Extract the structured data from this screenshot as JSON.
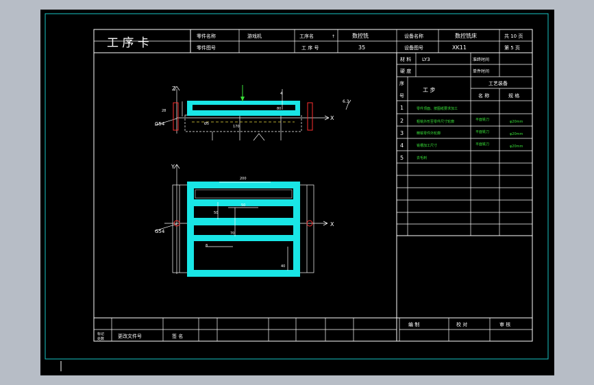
{
  "header": {
    "title": "工 序 卡",
    "part_name_label": "零件名称",
    "part_name_value": "游戏机",
    "part_no_label": "零件图号",
    "process_name_label": "工序名",
    "process_name_mark": "↑",
    "process_name_value": "数控铣",
    "process_no_label": "工 序 号",
    "process_no_value": "35",
    "equip_name_label": "设备名称",
    "equip_name_value": "数控铣床",
    "equip_no_label": "设备图号",
    "equip_no_value": "XK11",
    "total_pages": "共 10 页",
    "page_no": "第 5 页"
  },
  "info": {
    "material_label": "材 料",
    "material_value": "LY3",
    "hardness_label": "硬 度",
    "prep_time_label": "准终时间",
    "unit_time_label": "单件时间"
  },
  "steps_header": {
    "seq_label": "序",
    "no_label": "号",
    "step_label": "工 步",
    "equip_group_label": "工艺装备",
    "name_label": "名 称",
    "spec_label": "规 格"
  },
  "steps": [
    {
      "no": "1",
      "desc": "零件顶面、按图纸要求加工",
      "name": "",
      "spec": ""
    },
    {
      "no": "2",
      "desc": "粗铣外形至零件尺寸轮廓",
      "name": "平面铣刀",
      "spec": "φ20mm"
    },
    {
      "no": "3",
      "desc": "精铣零件外轮廓",
      "name": "平面铣刀",
      "spec": "φ20mm"
    },
    {
      "no": "4",
      "desc": "铣槽加工尺寸",
      "name": "平面铣刀",
      "spec": "φ20mm"
    },
    {
      "no": "5",
      "desc": "去毛刺",
      "name": "",
      "spec": ""
    }
  ],
  "footer": {
    "mark_label": "标记",
    "count_label": "处数",
    "change_doc_label": "更改文件号",
    "signature_label": "签 名",
    "drafted_label": "编 制",
    "checked_label": "校 对",
    "reviewed_label": "审 核"
  },
  "drawing": {
    "axis_z": "Z",
    "axis_x_top": "X",
    "axis_y": "Y",
    "axis_x_bottom": "X",
    "datum_top": "G54",
    "datum_bottom": "G54",
    "roughness": "6.3",
    "dim_top_1": "28",
    "dim_top_2": "170",
    "dim_top_3": "80",
    "dim_top_4": "Ø5",
    "dim_top_5": "4",
    "dim_bottom_1": "200",
    "dim_bottom_2": "50",
    "dim_bottom_3": "70",
    "dim_bottom_4": "8",
    "dim_bottom_5": "50",
    "dim_bottom_6": "40"
  },
  "colors": {
    "background": "#b7bdc6",
    "sheet": "#000000",
    "border": "#19c6c6",
    "lines": "#ffffff",
    "part": "#19e6e6",
    "step_text": "#38e038",
    "center_marks": "#ff3030"
  }
}
